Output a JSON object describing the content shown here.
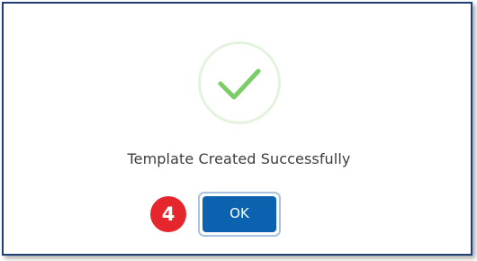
{
  "dialog": {
    "message": "Template Created Successfully",
    "ok_label": "OK",
    "step_number": "4",
    "icon": "checkmark-icon"
  },
  "colors": {
    "check_stroke": "#7ccc6a",
    "check_ring": "#e3f3dd",
    "button_fill": "#0b63b0",
    "button_outline": "#a8c3de",
    "badge_fill": "#e5262d",
    "frame_border": "#1f3f75"
  }
}
